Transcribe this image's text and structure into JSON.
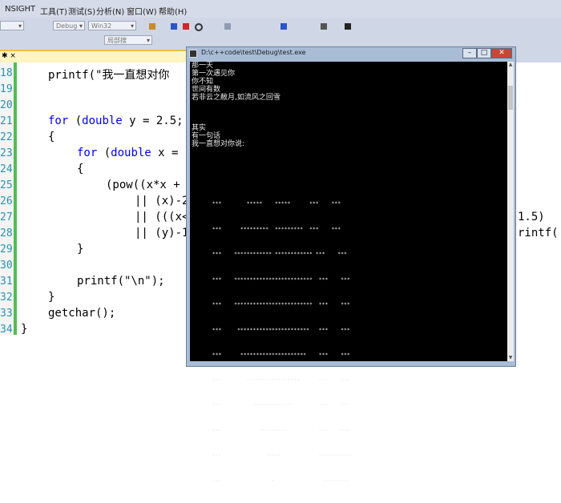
{
  "menu": [
    "NSIGHT",
    "工具(T)",
    "测试(S)",
    "分析(N)",
    "窗口(W)",
    "帮助(H)"
  ],
  "toolbar": {
    "config": "Debug",
    "platform": "Win32",
    "search_hint": "局部搜",
    "icons": [
      "bookmark-icon",
      "pause-icon",
      "stop-icon",
      "restart-icon"
    ]
  },
  "tab": {
    "label": "✱ ×"
  },
  "editor": {
    "line_numbers": [
      "18",
      "19",
      "20",
      "21",
      "22",
      "23",
      "24",
      "25",
      "26",
      "27",
      "28",
      "29",
      "30",
      "31",
      "32",
      "33",
      "34"
    ],
    "lines": {
      "l18": "printf(\"我一直想对你",
      "l21_kw": "for",
      "l21_kw2": "double",
      "l21_rest": " y = 2.5;",
      "l22": "{",
      "l23_kw": "for",
      "l23_kw2": "double",
      "l23_rest": " x =",
      "l24": "{",
      "l25": "(pow((x*x +",
      "l26": "|| (x)-2",
      "l27": "|| (((x<",
      "l27_right": "1.5)",
      "l28": "|| (y)-1",
      "l28_right": "rintf(",
      "l29": "}",
      "l31": "printf(\"\\n\");",
      "l32": "}",
      "l33": "getchar();",
      "l34": "}"
    }
  },
  "console": {
    "title": "D:\\c++code\\test\\Debug\\test.exe",
    "lines": [
      "那一天",
      "第一次遇见你",
      "你不知",
      "世间有数",
      "若非云之敝月,如流风之回雪"
    ],
    "lines2": [
      "其实",
      "有一句话",
      "我一直想对你说:"
    ],
    "art": [
      "  ***        *****    *****      ***    ***",
      "  ***      *********  *********  ***    ***",
      "  ***    ************ ************ ***    ***",
      "  ***    *************************  ***    ***",
      "  ***    *************************  ***    ***",
      "  ***     ***********************   ***    ***",
      "  ***      *********************    ***    ***",
      "  ***        *****************      ***    ***",
      "  ***          *************        ***    ***",
      "  ***            *********          ***    ***",
      "  ***              *****            ***********",
      "  ***                *               *********"
    ]
  }
}
